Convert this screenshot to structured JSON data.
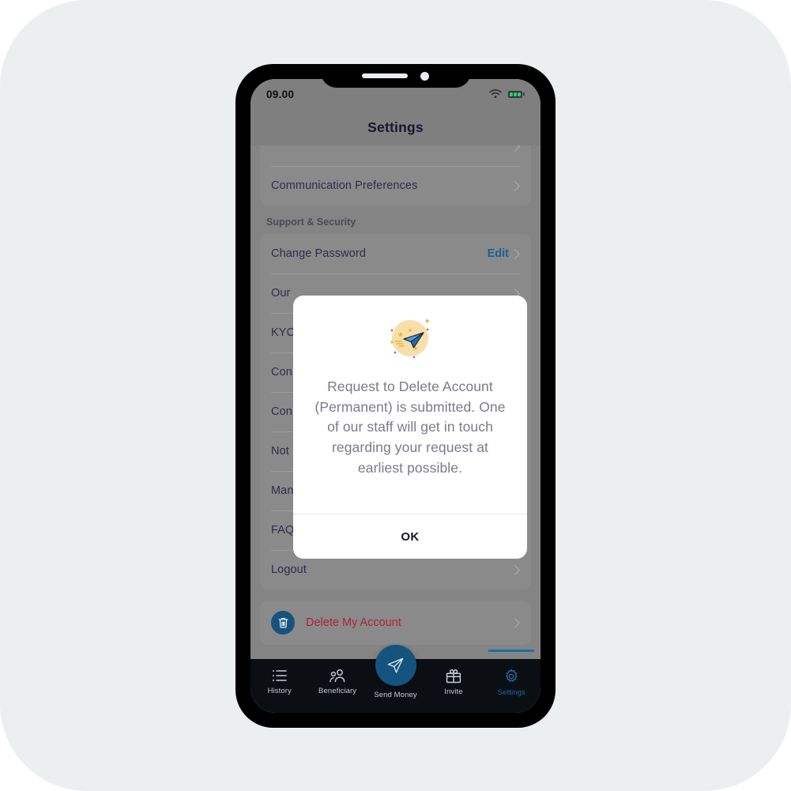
{
  "status_bar": {
    "time": "09.00",
    "wifi_icon": "wifi-icon",
    "battery_icon": "battery-icon"
  },
  "header": {
    "title": "Settings"
  },
  "settings_list": {
    "top_card_items": [
      {
        "label": "Communication Preferences",
        "chevron": "chevron-right-icon"
      }
    ],
    "section_title": "Support & Security",
    "items": [
      {
        "label": "Change Password",
        "action_label": "Edit",
        "chevron": "chevron-right-icon"
      },
      {
        "label": "Our",
        "action_label": "",
        "chevron": "chevron-right-icon"
      },
      {
        "label": "KYC",
        "action_label": "",
        "chevron": "chevron-right-icon"
      },
      {
        "label": "Con",
        "action_label": "",
        "chevron": "chevron-right-icon"
      },
      {
        "label": "Con",
        "action_label": "",
        "chevron": "chevron-right-icon"
      },
      {
        "label": "Not",
        "action_label": "",
        "chevron": "chevron-right-icon"
      },
      {
        "label": "Man",
        "action_label": "",
        "chevron": "chevron-right-icon"
      },
      {
        "label": "FAQs",
        "action_label": "",
        "chevron": "chevron-right-icon"
      },
      {
        "label": "Logout",
        "action_label": "",
        "chevron": "chevron-right-icon"
      }
    ],
    "danger": {
      "label": "Delete My Account",
      "icon": "trash-icon",
      "chevron": "chevron-right-icon",
      "color": "#b0203a",
      "icon_bg": "#14537d"
    }
  },
  "modal": {
    "illustration": "paper-plane-illustration",
    "message": "Request to Delete Account (Permanent) is submitted. One of our staff will get in touch regarding your request at earliest possible.",
    "ok_label": "OK"
  },
  "tab_bar": {
    "items": [
      {
        "label": "History",
        "icon": "list-icon",
        "active": false
      },
      {
        "label": "Beneficiary",
        "icon": "people-icon",
        "active": false
      },
      {
        "label": "Send Money",
        "icon": "paper-plane-icon",
        "active": false
      },
      {
        "label": "Invite",
        "icon": "gift-icon",
        "active": false
      },
      {
        "label": "Settings",
        "icon": "gear-icon",
        "active": true
      }
    ],
    "active_color": "#1d6ba3",
    "fab_color": "#14537d"
  }
}
